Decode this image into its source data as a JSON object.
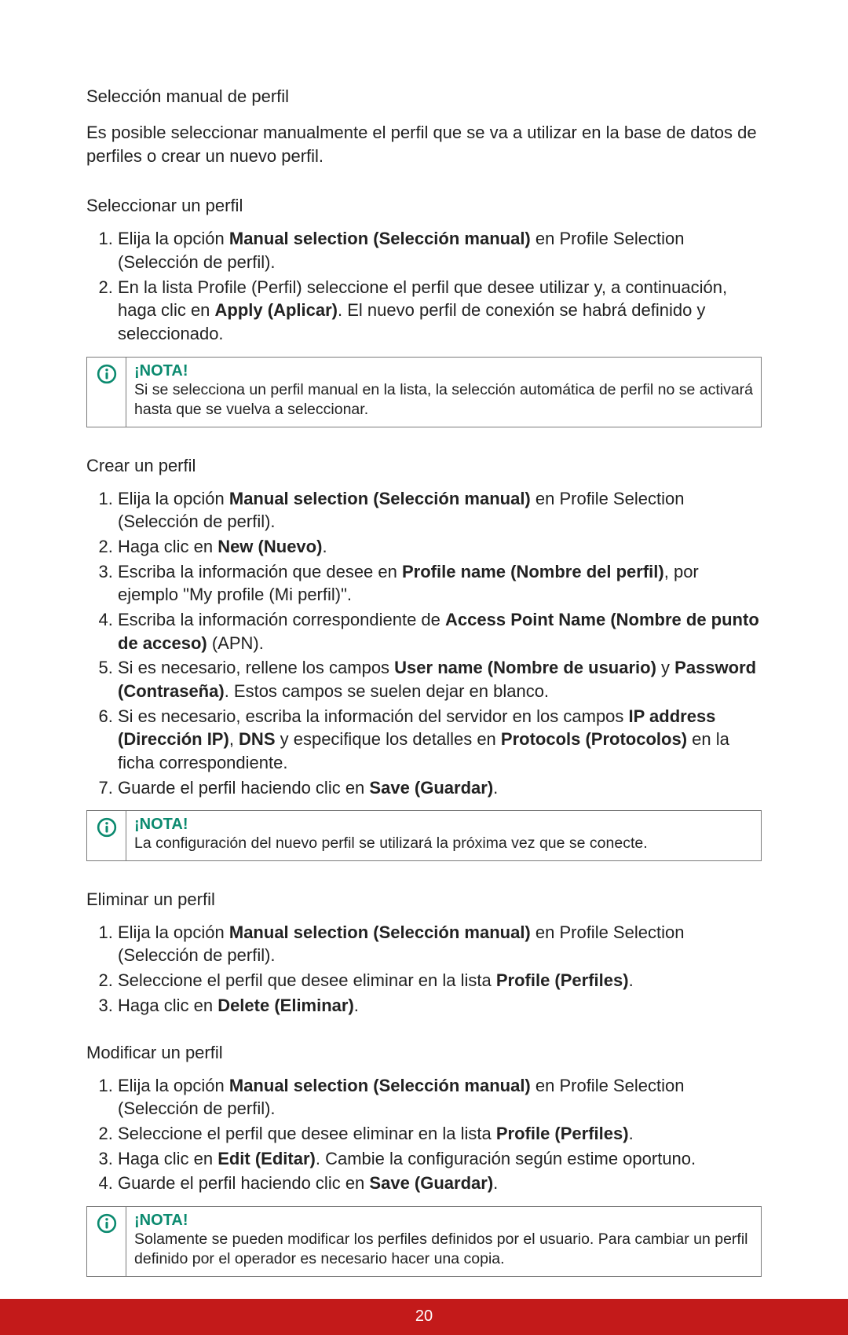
{
  "s1": {
    "heading": "Selección manual de perfil",
    "intro": "Es posible seleccionar manualmente el perfil que se va a utilizar en la base de datos de perfiles o crear un nuevo perfil."
  },
  "select": {
    "heading": "Seleccionar un perfil",
    "li1_a": "Elija la opción ",
    "li1_b": "Manual selection (Selección manual)",
    "li1_c": " en Profile Selection (Selección de perfil).",
    "li2_a": "En la lista Profile (Perfil) seleccione el perfil que desee utilizar y, a continuación, haga clic en ",
    "li2_b": "Apply (Aplicar)",
    "li2_c": ". El nuevo perfil de conexión se habrá definido y seleccionado.",
    "note_title": "¡NOTA!",
    "note_text": "Si se selecciona un perfil manual en la lista, la selección automática de perfil no se activará hasta que se vuelva a seleccionar."
  },
  "create": {
    "heading": "Crear un perfil",
    "li1_a": "Elija la opción ",
    "li1_b": "Manual selection (Selección manual)",
    "li1_c": " en Profile Selection (Selección de perfil).",
    "li2_a": "Haga clic en ",
    "li2_b": "New (Nuevo)",
    "li2_c": ".",
    "li3_a": "Escriba la información que desee en ",
    "li3_b": "Profile name (Nombre del perfil)",
    "li3_c": ", por ejemplo \"My profile (Mi perfil)\".",
    "li4_a": "Escriba la información correspondiente de ",
    "li4_b": "Access Point Name (Nombre de punto de acceso)",
    "li4_c": " (APN).",
    "li5_a": "Si es necesario, rellene los campos ",
    "li5_b": "User name (Nombre de usuario)",
    "li5_c": " y ",
    "li5_d": "Password (Contraseña)",
    "li5_e": ". Estos campos se suelen dejar en blanco.",
    "li6_a": "Si es necesario, escriba la información del servidor en los campos ",
    "li6_b": "IP address (Dirección IP)",
    "li6_c": ", ",
    "li6_d": "DNS",
    "li6_e": " y especifique los detalles en ",
    "li6_f": "Protocols (Protocolos)",
    "li6_g": " en la ficha correspondiente.",
    "li7_a": "Guarde el perfil haciendo clic en ",
    "li7_b": "Save (Guardar)",
    "li7_c": ".",
    "note_title": "¡NOTA!",
    "note_text": "La configuración del nuevo perfil se utilizará la próxima vez que se conecte."
  },
  "del": {
    "heading": "Eliminar un perfil",
    "li1_a": "Elija la opción ",
    "li1_b": "Manual selection (Selección manual)",
    "li1_c": " en Profile Selection (Selección de perfil).",
    "li2_a": "Seleccione el perfil que desee eliminar en la lista ",
    "li2_b": "Profile (Perfiles)",
    "li2_c": ".",
    "li3_a": "Haga clic en ",
    "li3_b": "Delete (Eliminar)",
    "li3_c": "."
  },
  "mod": {
    "heading": "Modificar un perfil",
    "li1_a": "Elija la opción ",
    "li1_b": "Manual selection (Selección manual)",
    "li1_c": " en Profile Selection (Selección de perfil).",
    "li2_a": "Seleccione el perfil que desee eliminar en la lista ",
    "li2_b": "Profile (Perfiles)",
    "li2_c": ".",
    "li3_a": "Haga clic en ",
    "li3_b": "Edit (Editar)",
    "li3_c": ". Cambie la configuración según estime oportuno.",
    "li4_a": "Guarde el perfil haciendo clic en ",
    "li4_b": "Save (Guardar)",
    "li4_c": ".",
    "note_title": "¡NOTA!",
    "note_text": "Solamente se pueden modificar los perfiles definidos por el usuario. Para cambiar un perfil definido por el operador es necesario hacer una copia."
  },
  "page_number": "20"
}
